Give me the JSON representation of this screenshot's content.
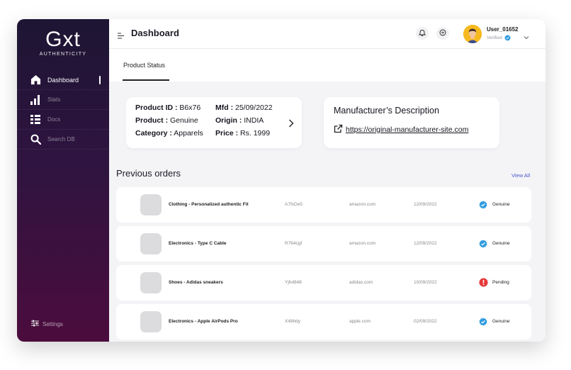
{
  "brand": {
    "logo_text": "Gxt",
    "logo_sub": "AUTHENTICITY"
  },
  "sidebar": {
    "items": [
      {
        "label": "Dashboard",
        "icon": "home-icon",
        "active": true
      },
      {
        "label": "Stats",
        "icon": "bar-chart-icon",
        "active": false
      },
      {
        "label": "Docs",
        "icon": "list-icon",
        "active": false
      },
      {
        "label": "Search DB",
        "icon": "search-icon",
        "active": false
      }
    ],
    "settings_label": "Settings"
  },
  "header": {
    "title": "Dashboard",
    "user_name": "User_01652",
    "user_status": "Verified"
  },
  "tabs": [
    {
      "label": "Product Status",
      "active": true
    }
  ],
  "product": {
    "id_label": "Product ID :",
    "id_value": "B6x76",
    "mfd_label": "Mfd :",
    "mfd_value": "25/09/2022",
    "product_label": "Product :",
    "product_value": "Genuine",
    "origin_label": "Origin :",
    "origin_value": "INDIA",
    "category_label": "Category :",
    "category_value": "Apparels",
    "price_label": "Price :",
    "price_value": "Rs. 1999"
  },
  "manufacturer": {
    "title": "Manufacturer’s Description",
    "link": "https://original-manufacturer-site.com"
  },
  "orders": {
    "title": "Previous orders",
    "view_all": "View All",
    "rows": [
      {
        "name": "Clothing - Personalized authentic Fit",
        "id": "A7fxDe5",
        "site": "amazon.com",
        "date": "12/09/2022",
        "status": "Genuine"
      },
      {
        "name": "Electronics - Type C Cable",
        "id": "R764cgf",
        "site": "amazon.com",
        "date": "12/09/2022",
        "status": "Genuine"
      },
      {
        "name": "Shoes - Adidas sneakers",
        "id": "Yjhd848",
        "site": "adidas.com",
        "date": "10/09/2022",
        "status": "Pending"
      },
      {
        "name": "Electronics - Apple AirPods Pro",
        "id": "X48hdy",
        "site": "apple.com",
        "date": "02/09/2022",
        "status": "Genuine"
      }
    ]
  },
  "colors": {
    "accent": "#4a55c8",
    "verified": "#2f9be0",
    "pending": "#e5393a",
    "sidebar_top": "#1d1533",
    "sidebar_bottom": "#4b0c3d"
  }
}
